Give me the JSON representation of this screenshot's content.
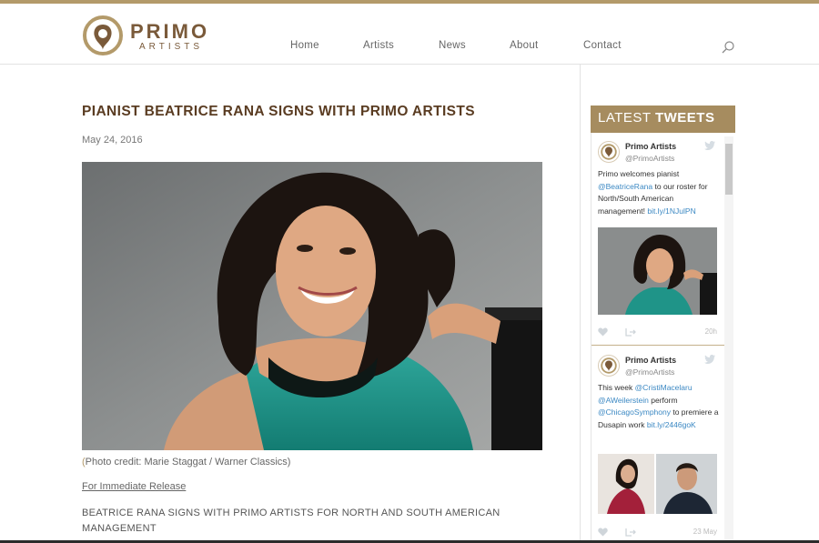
{
  "brand": {
    "name": "PRIMO",
    "sub": "ARTISTS",
    "accent": "#b39a6a",
    "title_color": "#5a3c22"
  },
  "nav": {
    "items": [
      "Home",
      "Artists",
      "News",
      "About",
      "Contact"
    ],
    "search_icon": "search-icon"
  },
  "article": {
    "title": "PIANIST BEATRICE RANA SIGNS WITH PRIMO ARTISTS",
    "date": "May 24, 2016",
    "caption_open": "(",
    "caption": "Photo credit: Marie Staggat / Warner Classics)",
    "release": "For Immediate Release",
    "lead": "BEATRICE RANA SIGNS WITH PRIMO ARTISTS FOR NORTH AND SOUTH AMERICAN MANAGEMENT"
  },
  "tweets_widget": {
    "title_light": "LATEST ",
    "title_bold": "TWEETS",
    "tweets": [
      {
        "name": "Primo Artists",
        "handle": "@PrimoArtists",
        "text_parts": [
          {
            "t": "Primo welcomes pianist "
          },
          {
            "t": "@BeatriceRana",
            "link": true
          },
          {
            "t": " to our roster for North/South American management! "
          },
          {
            "t": "bit.ly/1NJulPN",
            "link": true
          }
        ],
        "time": "20h"
      },
      {
        "name": "Primo Artists",
        "handle": "@PrimoArtists",
        "text_parts": [
          {
            "t": "This week "
          },
          {
            "t": "@CristiMacelaru",
            "link": true
          },
          {
            "t": " "
          },
          {
            "t": "@AWeilerstein",
            "link": true
          },
          {
            "t": " perform "
          },
          {
            "t": "@ChicagoSymphony",
            "link": true
          },
          {
            "t": " to premiere a Dusapin work "
          },
          {
            "t": "bit.ly/2446goK",
            "link": true
          }
        ],
        "time": "23 May"
      }
    ]
  }
}
